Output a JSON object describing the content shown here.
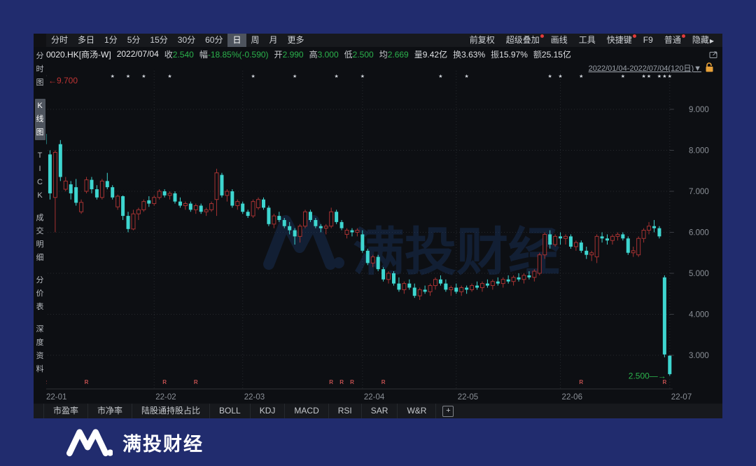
{
  "window": {
    "frame_color": "#212c6e",
    "app_bg": "#0d0f13"
  },
  "toolbar": {
    "period_tabs": [
      {
        "label": "分时"
      },
      {
        "label": "多日"
      },
      {
        "label": "1分"
      },
      {
        "label": "5分"
      },
      {
        "label": "15分"
      },
      {
        "label": "30分"
      },
      {
        "label": "60分"
      },
      {
        "label": "日",
        "selected": true
      },
      {
        "label": "周"
      },
      {
        "label": "月"
      },
      {
        "label": "更多"
      }
    ],
    "tools": [
      {
        "label": "前复权"
      },
      {
        "label": "超级叠加",
        "badge": true
      },
      {
        "label": "画线"
      },
      {
        "label": "工具"
      },
      {
        "label": "快捷键",
        "badge": true
      },
      {
        "label": "F9"
      },
      {
        "label": "普通",
        "badge": true
      },
      {
        "label": "隐藏",
        "arrow": "▶"
      }
    ]
  },
  "info_bar": {
    "symbol": "0020.HK[商汤-W]",
    "date": "2022/07/04",
    "fields": [
      {
        "label": "收",
        "value": "2.540",
        "color": "green"
      },
      {
        "label": "幅",
        "value": "-18.85%(-0.590)",
        "color": "green"
      },
      {
        "label": "开",
        "value": "2.990",
        "color": "green"
      },
      {
        "label": "高",
        "value": "3.000",
        "color": "green"
      },
      {
        "label": "低",
        "value": "2.500",
        "color": "green"
      },
      {
        "label": "均",
        "value": "2.669",
        "color": "green"
      },
      {
        "label": "量",
        "value": "9.42亿",
        "color": "white"
      },
      {
        "label": "换",
        "value": "3.63%",
        "color": "white"
      },
      {
        "label": "振",
        "value": "15.97%",
        "color": "white"
      },
      {
        "label": "额",
        "value": "25.15亿",
        "color": "white"
      }
    ]
  },
  "sidebar": {
    "items": [
      {
        "label": "分时图"
      },
      {
        "label": "K线图",
        "selected": true
      },
      {
        "label": "TICK"
      },
      {
        "label": "成交明细"
      },
      {
        "label": "分价表"
      },
      {
        "label": "深度资料"
      }
    ]
  },
  "chart_data": {
    "type": "candlestick",
    "title": "0020.HK 商汤-W 日K线",
    "date_range_label": "2022/01/04-2022/07/04(120日)▼",
    "y_ticks": [
      "9.000",
      "8.000",
      "7.000",
      "6.000",
      "5.000",
      "4.000",
      "3.000"
    ],
    "y_tick_values": [
      9,
      8,
      7,
      6,
      5,
      4,
      3
    ],
    "ylim": [
      2.2,
      9.95
    ],
    "x_labels": [
      {
        "index": 0,
        "label": "22-01"
      },
      {
        "index": 21,
        "label": "22-02"
      },
      {
        "index": 38,
        "label": "22-03"
      },
      {
        "index": 61,
        "label": "22-04"
      },
      {
        "index": 79,
        "label": "22-05"
      },
      {
        "index": 99,
        "label": "22-06"
      },
      {
        "index": 120,
        "label": "22-07"
      }
    ],
    "candles_ohlc": [
      [
        8.4,
        9.7,
        7.7,
        8.15
      ],
      [
        7.9,
        8.0,
        6.8,
        6.95
      ],
      [
        6.85,
        8.0,
        6.0,
        7.95
      ],
      [
        8.15,
        8.25,
        7.25,
        7.35
      ],
      [
        7.05,
        7.35,
        7.0,
        7.25
      ],
      [
        7.17,
        7.25,
        6.8,
        6.95
      ],
      [
        7.1,
        7.3,
        6.65,
        6.72
      ],
      [
        6.5,
        6.8,
        6.45,
        6.73
      ],
      [
        7.0,
        7.35,
        6.95,
        7.28
      ],
      [
        7.28,
        7.35,
        6.95,
        7.05
      ],
      [
        7.05,
        7.15,
        6.8,
        6.85
      ],
      [
        6.85,
        7.3,
        6.8,
        7.25
      ],
      [
        7.25,
        7.45,
        7.05,
        7.1
      ],
      [
        7.1,
        7.15,
        6.8,
        6.85
      ],
      [
        6.62,
        6.92,
        6.55,
        6.88
      ],
      [
        6.88,
        6.9,
        6.3,
        6.4
      ],
      [
        6.4,
        6.5,
        6.0,
        6.08
      ],
      [
        6.08,
        6.55,
        6.05,
        6.45
      ],
      [
        6.45,
        6.6,
        6.3,
        6.55
      ],
      [
        6.55,
        6.8,
        6.5,
        6.75
      ],
      [
        6.78,
        6.88,
        6.62,
        6.7
      ],
      [
        6.7,
        6.9,
        6.65,
        6.85
      ],
      [
        6.85,
        7.05,
        6.8,
        7.0
      ],
      [
        7.0,
        7.05,
        6.85,
        6.9
      ],
      [
        6.9,
        7.0,
        6.8,
        6.95
      ],
      [
        6.95,
        7.0,
        6.7,
        6.75
      ],
      [
        6.75,
        6.85,
        6.6,
        6.65
      ],
      [
        6.65,
        6.75,
        6.55,
        6.7
      ],
      [
        6.7,
        6.75,
        6.5,
        6.55
      ],
      [
        6.55,
        6.7,
        6.45,
        6.65
      ],
      [
        6.65,
        6.7,
        6.45,
        6.5
      ],
      [
        6.5,
        6.6,
        6.4,
        6.55
      ],
      [
        6.55,
        6.75,
        6.5,
        6.7
      ],
      [
        6.8,
        7.55,
        6.4,
        7.45
      ],
      [
        7.4,
        7.45,
        6.85,
        6.9
      ],
      [
        6.9,
        7.05,
        6.75,
        7.0
      ],
      [
        7.0,
        7.05,
        6.6,
        6.65
      ],
      [
        6.65,
        6.8,
        6.55,
        6.75
      ],
      [
        6.7,
        6.75,
        6.45,
        6.5
      ],
      [
        6.5,
        6.55,
        6.35,
        6.4
      ],
      [
        6.4,
        6.8,
        6.35,
        6.75
      ],
      [
        6.6,
        6.85,
        6.55,
        6.8
      ],
      [
        6.8,
        6.85,
        6.55,
        6.6
      ],
      [
        6.6,
        6.65,
        6.15,
        6.2
      ],
      [
        6.2,
        6.45,
        6.1,
        6.4
      ],
      [
        6.4,
        6.5,
        6.25,
        6.3
      ],
      [
        6.3,
        6.35,
        6.1,
        6.15
      ],
      [
        6.15,
        6.25,
        5.95,
        6.05
      ],
      [
        6.05,
        6.1,
        5.7,
        5.9
      ],
      [
        5.9,
        6.2,
        5.75,
        6.15
      ],
      [
        6.15,
        6.55,
        6.1,
        6.5
      ],
      [
        6.5,
        6.55,
        6.25,
        6.3
      ],
      [
        6.3,
        6.35,
        6.1,
        6.15
      ],
      [
        6.15,
        6.2,
        6.0,
        6.1
      ],
      [
        6.1,
        6.2,
        5.95,
        6.15
      ],
      [
        6.15,
        6.6,
        6.1,
        6.5
      ],
      [
        6.5,
        6.55,
        6.2,
        6.25
      ],
      [
        6.25,
        6.3,
        6.05,
        6.1
      ],
      [
        5.95,
        6.1,
        5.85,
        6.05
      ],
      [
        6.05,
        6.1,
        5.9,
        6.0
      ],
      [
        6.0,
        6.1,
        5.9,
        6.05
      ],
      [
        5.95,
        6.05,
        5.5,
        5.55
      ],
      [
        5.55,
        5.6,
        5.2,
        5.25
      ],
      [
        5.25,
        5.45,
        5.15,
        5.4
      ],
      [
        5.4,
        5.45,
        5.05,
        5.1
      ],
      [
        5.1,
        5.15,
        4.8,
        4.85
      ],
      [
        4.85,
        5.05,
        4.75,
        5.0
      ],
      [
        5.0,
        5.05,
        4.7,
        4.75
      ],
      [
        4.75,
        4.9,
        4.55,
        4.6
      ],
      [
        4.6,
        4.8,
        4.5,
        4.75
      ],
      [
        4.75,
        4.85,
        4.6,
        4.65
      ],
      [
        4.65,
        4.75,
        4.4,
        4.45
      ],
      [
        4.45,
        4.65,
        4.35,
        4.6
      ],
      [
        4.6,
        4.7,
        4.5,
        4.55
      ],
      [
        4.55,
        4.75,
        4.45,
        4.7
      ],
      [
        4.7,
        4.9,
        4.6,
        4.85
      ],
      [
        4.85,
        4.95,
        4.7,
        4.75
      ],
      [
        4.75,
        4.85,
        4.55,
        4.6
      ],
      [
        4.6,
        4.7,
        4.45,
        4.65
      ],
      [
        4.65,
        4.75,
        4.5,
        4.55
      ],
      [
        4.55,
        4.7,
        4.45,
        4.65
      ],
      [
        4.65,
        4.7,
        4.5,
        4.6
      ],
      [
        4.6,
        4.75,
        4.55,
        4.7
      ],
      [
        4.7,
        4.8,
        4.6,
        4.65
      ],
      [
        4.65,
        4.8,
        4.55,
        4.75
      ],
      [
        4.75,
        4.85,
        4.65,
        4.7
      ],
      [
        4.7,
        4.85,
        4.6,
        4.8
      ],
      [
        4.8,
        4.9,
        4.7,
        4.75
      ],
      [
        4.75,
        4.9,
        4.65,
        4.85
      ],
      [
        4.85,
        4.95,
        4.75,
        4.8
      ],
      [
        4.8,
        4.95,
        4.7,
        4.9
      ],
      [
        4.9,
        5.0,
        4.8,
        4.85
      ],
      [
        4.85,
        5.0,
        4.75,
        4.95
      ],
      [
        4.95,
        5.05,
        4.85,
        4.9
      ],
      [
        4.9,
        5.1,
        4.8,
        5.05
      ],
      [
        5.0,
        5.5,
        4.95,
        5.45
      ],
      [
        5.45,
        6.0,
        5.35,
        5.95
      ],
      [
        5.95,
        6.05,
        5.6,
        5.7
      ],
      [
        5.7,
        5.95,
        5.65,
        5.9
      ],
      [
        5.9,
        6.0,
        5.7,
        5.85
      ],
      [
        5.85,
        5.95,
        5.7,
        5.9
      ],
      [
        5.9,
        5.95,
        5.6,
        5.65
      ],
      [
        5.65,
        5.8,
        5.55,
        5.75
      ],
      [
        5.75,
        5.8,
        5.5,
        5.55
      ],
      [
        5.55,
        5.65,
        5.35,
        5.45
      ],
      [
        5.45,
        5.55,
        5.3,
        5.5
      ],
      [
        5.4,
        5.95,
        5.25,
        5.9
      ],
      [
        5.9,
        6.0,
        5.75,
        5.85
      ],
      [
        5.85,
        5.95,
        5.7,
        5.8
      ],
      [
        5.8,
        5.95,
        5.7,
        5.9
      ],
      [
        5.9,
        6.0,
        5.8,
        5.95
      ],
      [
        5.95,
        6.0,
        5.8,
        5.85
      ],
      [
        5.85,
        5.9,
        5.45,
        5.5
      ],
      [
        5.5,
        5.65,
        5.4,
        5.55
      ],
      [
        5.45,
        5.9,
        5.4,
        5.85
      ],
      [
        5.85,
        6.1,
        5.75,
        6.05
      ],
      [
        6.05,
        6.25,
        5.95,
        6.15
      ],
      [
        6.15,
        6.3,
        6.0,
        6.1
      ],
      [
        6.1,
        6.15,
        5.85,
        5.9
      ],
      [
        4.9,
        4.95,
        2.95,
        3.02
      ],
      [
        2.99,
        3.0,
        2.5,
        2.54
      ]
    ],
    "event_star_indices": [
      0,
      13,
      16,
      19,
      24,
      40,
      48,
      56,
      61,
      76,
      81,
      97,
      99,
      103,
      111,
      115,
      116,
      118,
      119,
      120
    ],
    "r_marker_indices": [
      0,
      8,
      23,
      29,
      55,
      57,
      59,
      65,
      103,
      119
    ],
    "r_label": "R",
    "annotations": {
      "high": {
        "text": "9.700",
        "value": 9.7
      },
      "low": {
        "text": "2.500",
        "value": 2.5
      }
    },
    "watermark": "满投财经",
    "legend_position": "none",
    "grid": true,
    "colors": {
      "up": "#a63232",
      "down": "#3ed6d0",
      "high_label": "#bf3434",
      "low_label": "#2bb24c",
      "grid": "#26292e",
      "axis_text": "#8b9097",
      "star": "#cfd3d9",
      "r_marker": "#c25050",
      "date_range": "#9aa0a8",
      "lock": "#e8a23a",
      "watermark": "#1e3f73"
    }
  },
  "bottom_bar": {
    "tabs": [
      "市盈率",
      "市净率",
      "陆股通持股占比",
      "BOLL",
      "KDJ",
      "MACD",
      "RSI",
      "SAR",
      "W&R"
    ],
    "add_label": "+"
  },
  "footer": {
    "brand": "满投财经"
  },
  "icons": {
    "popout": "popout-icon",
    "lock": "lock-open-icon",
    "star": "event-star-icon"
  }
}
